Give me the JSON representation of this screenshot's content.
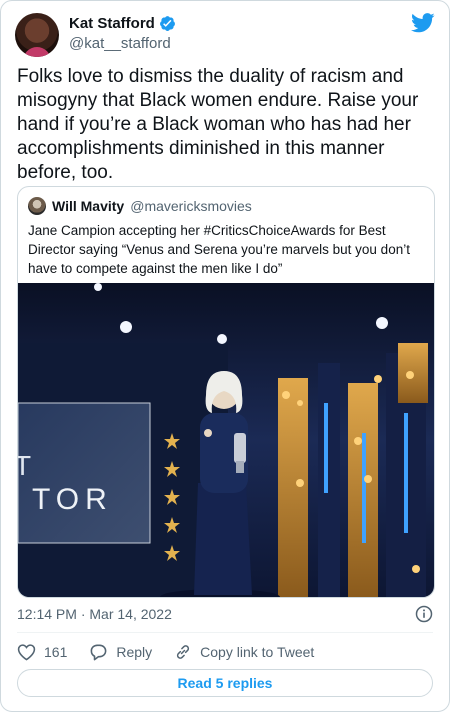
{
  "colors": {
    "accent": "#1d9bf0",
    "text": "#0f1419",
    "secondary": "#536471",
    "border": "#cfd9de"
  },
  "author": {
    "display_name": "Kat Stafford",
    "handle": "@kat__stafford",
    "verified": true
  },
  "tweet": {
    "text": "Folks love to dismiss the duality of racism and misogyny that Black women endure. Raise your hand if you’re a Black woman who has had her accomplishments diminished in this manner before, too."
  },
  "quoted_tweet": {
    "display_name": "Will Mavity",
    "handle": "@mavericksmovies",
    "text": "Jane Campion accepting her #CriticsChoiceAwards for Best Director saying “Venus and Serena you’re marvels but you don’t have to compete against the men like I do”",
    "photo_text": "TOR",
    "photo_text_partial": "T"
  },
  "meta": {
    "timestamp": "12:14 PM · Mar 14, 2022"
  },
  "actions": {
    "like_count": "161",
    "reply_label": "Reply",
    "copy_link_label": "Copy link to Tweet"
  },
  "read_replies_label": "Read 5 replies",
  "icons": [
    "twitter-logo",
    "verified-badge",
    "info-icon",
    "heart-icon",
    "reply-icon",
    "link-icon"
  ]
}
